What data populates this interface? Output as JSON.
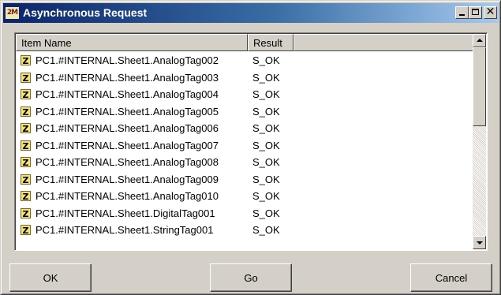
{
  "window": {
    "title": "Asynchronous Request",
    "icon": "app-icon",
    "title_icon_text": "2M"
  },
  "listview": {
    "columns": [
      {
        "label": "Item Name"
      },
      {
        "label": "Result"
      }
    ],
    "rows": [
      {
        "icon": "tag-icon",
        "glyph": "Z",
        "name": "PC1.#INTERNAL.Sheet1.AnalogTag002",
        "result": "S_OK"
      },
      {
        "icon": "tag-icon",
        "glyph": "Z",
        "name": "PC1.#INTERNAL.Sheet1.AnalogTag003",
        "result": "S_OK"
      },
      {
        "icon": "tag-icon",
        "glyph": "Z",
        "name": "PC1.#INTERNAL.Sheet1.AnalogTag004",
        "result": "S_OK"
      },
      {
        "icon": "tag-icon",
        "glyph": "Z",
        "name": "PC1.#INTERNAL.Sheet1.AnalogTag005",
        "result": "S_OK"
      },
      {
        "icon": "tag-icon",
        "glyph": "Z",
        "name": "PC1.#INTERNAL.Sheet1.AnalogTag006",
        "result": "S_OK"
      },
      {
        "icon": "tag-icon",
        "glyph": "Z",
        "name": "PC1.#INTERNAL.Sheet1.AnalogTag007",
        "result": "S_OK"
      },
      {
        "icon": "tag-icon",
        "glyph": "Z",
        "name": "PC1.#INTERNAL.Sheet1.AnalogTag008",
        "result": "S_OK"
      },
      {
        "icon": "tag-icon",
        "glyph": "Z",
        "name": "PC1.#INTERNAL.Sheet1.AnalogTag009",
        "result": "S_OK"
      },
      {
        "icon": "tag-icon",
        "glyph": "Z",
        "name": "PC1.#INTERNAL.Sheet1.AnalogTag010",
        "result": "S_OK"
      },
      {
        "icon": "tag-icon",
        "glyph": "Z",
        "name": "PC1.#INTERNAL.Sheet1.DigitalTag001",
        "result": "S_OK"
      },
      {
        "icon": "tag-icon",
        "glyph": "Z",
        "name": "PC1.#INTERNAL.Sheet1.StringTag001",
        "result": "S_OK"
      }
    ]
  },
  "buttons": {
    "ok": "OK",
    "go": "Go",
    "cancel": "Cancel"
  },
  "caption_buttons": {
    "minimize": "minimize-icon",
    "maximize": "maximize-icon",
    "close": "close-icon",
    "close_glyph": "✕"
  },
  "colors": {
    "titlebar_start": "#0a246a",
    "titlebar_end": "#a6caf0",
    "face": "#d4d0c8"
  }
}
